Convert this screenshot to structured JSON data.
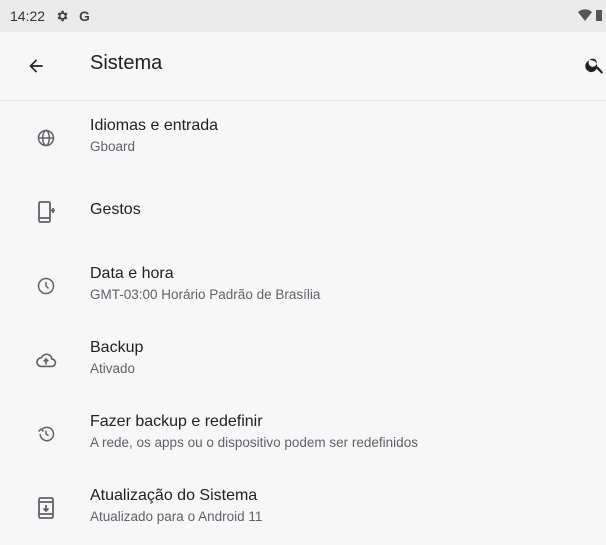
{
  "status_bar": {
    "time": "14:22",
    "icons": [
      "gear-icon",
      "google-g-icon",
      "wifi-icon",
      "battery-icon"
    ],
    "g_label": "G"
  },
  "app_bar": {
    "title": "Sistema",
    "back_icon": "arrow-back-icon",
    "search_icon": "search-icon"
  },
  "settings": [
    {
      "icon": "globe-icon",
      "title": "Idiomas e entrada",
      "summary": "Gboard"
    },
    {
      "icon": "gesture-phone-icon",
      "title": "Gestos",
      "summary": ""
    },
    {
      "icon": "clock-icon",
      "title": "Data e hora",
      "summary": "GMT-03:00 Horário Padrão de Brasília"
    },
    {
      "icon": "cloud-upload-icon",
      "title": "Backup",
      "summary": "Ativado"
    },
    {
      "icon": "restore-icon",
      "title": "Fazer backup e redefinir",
      "summary": "A rede, os apps ou o dispositivo podem ser redefinidos"
    },
    {
      "icon": "system-update-icon",
      "title": "Atualização do Sistema",
      "summary": "Atualizado para o Android 11"
    }
  ],
  "colors": {
    "background": "#f7f7f7",
    "status_bar": "#eaeaea",
    "title_text": "#202124",
    "summary_text": "#5f6368",
    "icon": "#5f6368"
  }
}
